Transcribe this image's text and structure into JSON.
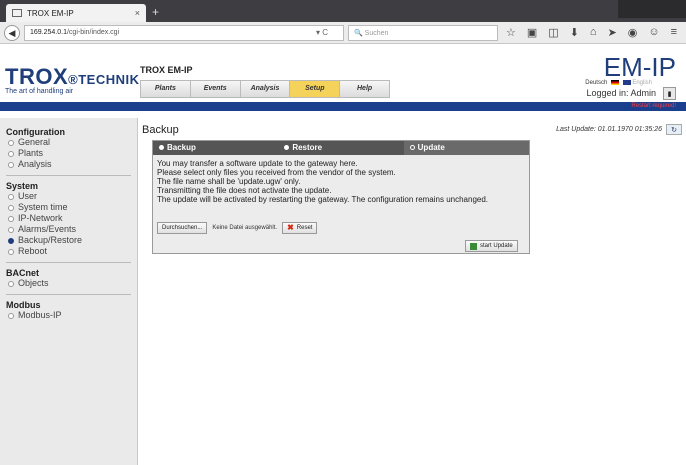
{
  "browser": {
    "tab_title": "TROX EM-IP",
    "tab_close": "×",
    "new_tab": "+",
    "url_host": "169.254.0.1",
    "url_path": "/cgi-bin/index.cgi",
    "search_placeholder": "Suchen",
    "reload": "▾ C",
    "icons": [
      "bookmark-star-icon",
      "clipboard-icon",
      "pocket-icon",
      "download-icon",
      "home-icon",
      "send-icon",
      "hello-icon",
      "emoji-icon",
      "menu-icon"
    ]
  },
  "header": {
    "brand": "TROX",
    "brand_sub": "®TECHNIK",
    "tagline": "The art of handling air",
    "product": "TROX EM-IP",
    "nav": [
      "Plants",
      "Events",
      "Analysis",
      "Setup",
      "Help"
    ],
    "active_nav": "Setup",
    "product_logo": "EM-IP",
    "language": "Deutsch",
    "language_alt": "English",
    "logged_in": "Logged in: Admin",
    "restart_notice": "Restart required!"
  },
  "sidebar": {
    "sections": [
      {
        "title": "Configuration",
        "items": [
          "General",
          "Plants",
          "Analysis"
        ]
      },
      {
        "title": "System",
        "items": [
          "User",
          "System time",
          "IP-Network",
          "Alarms/Events",
          "Backup/Restore",
          "Reboot"
        ]
      },
      {
        "title": "BACnet",
        "items": [
          "Objects"
        ]
      },
      {
        "title": "Modbus",
        "items": [
          "Modbus-IP"
        ]
      }
    ],
    "selected": "Backup/Restore"
  },
  "main": {
    "title": "Backup",
    "last_update": "Last Update: 01.01.1970 01:35:26",
    "tabs": [
      "Backup",
      "Restore",
      "Update"
    ],
    "active_tab": "Update",
    "info_lines": [
      "You may transfer a software update to the gateway here.",
      "Please select only files you received from the vendor of the system.",
      "The file name shall be 'update.ugw' only.",
      "Transmitting the file does not activate the update.",
      "The update will be activated by restarting the gateway. The configuration remains unchanged."
    ],
    "browse_label": "Durchsuchen...",
    "file_status": "Keine Datei ausgewählt.",
    "reset_label": "Reset",
    "start_update_label": "start Update"
  },
  "colors": {
    "brand_blue": "#1f3e7a",
    "nav_active": "#f5d35a",
    "restart_red": "#ff3a3a",
    "panel_header": "#555555"
  }
}
